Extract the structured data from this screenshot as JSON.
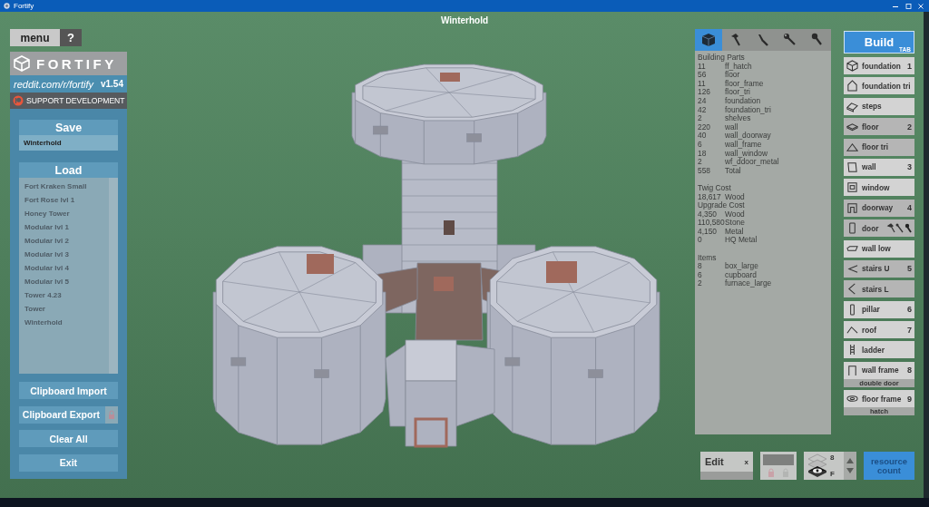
{
  "window": {
    "title": "Fortify"
  },
  "scene_title": "Winterhold",
  "menu": {
    "menu_button": "menu",
    "help_button": "?"
  },
  "brand": {
    "logo": "FORTIFY",
    "link": "reddit.com/r/fortify",
    "version": "v1.54",
    "support": "SUPPORT DEVELOPMENT"
  },
  "save": {
    "button": "Save",
    "value": "Winterhold"
  },
  "load": {
    "button": "Load",
    "items": [
      "Fort Kraken Small",
      "Fort Rose lvl 1",
      "Honey Tower",
      "Modular lvl 1",
      "Modular lvl 2",
      "Modular lvl 3",
      "Modular lvl 4",
      "Modular lvl 5",
      "Tower 4.23",
      "Tower",
      "Winterhold"
    ]
  },
  "actions": [
    {
      "label": "Clipboard Import",
      "locked": false
    },
    {
      "label": "Clipboard Export",
      "locked": true
    },
    {
      "label": "Clear All",
      "locked": false
    },
    {
      "label": "Exit",
      "locked": false
    }
  ],
  "stats": {
    "tabs": [
      {
        "selected": true
      },
      {
        "selected": false
      },
      {
        "selected": false
      },
      {
        "selected": false
      },
      {
        "selected": false
      }
    ],
    "groups": [
      {
        "sections": [
          {
            "title": "Building Parts",
            "rows": [
              {
                "count": "11",
                "name": "ff_hatch"
              },
              {
                "count": "56",
                "name": "floor"
              },
              {
                "count": "11",
                "name": "floor_frame"
              },
              {
                "count": "126",
                "name": "floor_tri"
              },
              {
                "count": "24",
                "name": "foundation"
              },
              {
                "count": "42",
                "name": "foundation_tri"
              },
              {
                "count": "2",
                "name": "shelves"
              },
              {
                "count": "220",
                "name": "wall"
              },
              {
                "count": "40",
                "name": "wall_doorway"
              },
              {
                "count": "6",
                "name": "wall_frame"
              },
              {
                "count": "18",
                "name": "wall_window"
              },
              {
                "count": "2",
                "name": "wf_ddoor_metal"
              },
              {
                "count": "558",
                "name": "Total"
              }
            ]
          }
        ]
      },
      {
        "sections": [
          {
            "title": "Twig Cost",
            "rows": [
              {
                "count": "18,617",
                "name": "Wood"
              }
            ]
          },
          {
            "title": "Upgrade Cost",
            "rows": [
              {
                "count": "4,350",
                "name": "Wood"
              },
              {
                "count": "110,580",
                "name": "Stone"
              },
              {
                "count": "4,150",
                "name": "Metal"
              },
              {
                "count": "0",
                "name": "HQ Metal"
              }
            ]
          }
        ]
      },
      {
        "sections": [
          {
            "title": "Items",
            "rows": [
              {
                "count": "8",
                "name": "box_large"
              },
              {
                "count": "6",
                "name": "cupboard"
              },
              {
                "count": "2",
                "name": "furnace_large"
              }
            ]
          }
        ]
      }
    ]
  },
  "build": {
    "button": "Build",
    "shortcut": "TAB",
    "items": [
      {
        "kind": "plain",
        "label": "foundation",
        "key": "1",
        "dimmed": false
      },
      {
        "kind": "plain",
        "label": "foundation tri",
        "dimmed": false
      },
      {
        "kind": "plain",
        "label": "steps",
        "dimmed": false
      },
      {
        "kind": "plain",
        "label": "floor",
        "key": "2",
        "dimmed": true
      },
      {
        "kind": "plain",
        "label": "floor tri",
        "dimmed": true
      },
      {
        "kind": "plain",
        "label": "wall",
        "key": "3",
        "dimmed": false
      },
      {
        "kind": "plain",
        "label": "window",
        "dimmed": false
      },
      {
        "kind": "plain",
        "label": "doorway",
        "key": "4",
        "dimmed": true
      },
      {
        "kind": "tools",
        "label": "door",
        "dimmed": true
      },
      {
        "kind": "plain",
        "label": "wall low",
        "dimmed": false
      },
      {
        "kind": "plain",
        "label": "stairs U",
        "key": "5",
        "dimmed": true
      },
      {
        "kind": "plain",
        "label": "stairs L",
        "dimmed": true
      },
      {
        "kind": "plain",
        "label": "pillar",
        "key": "6",
        "dimmed": false
      },
      {
        "kind": "plain",
        "label": "roof",
        "key": "7",
        "dimmed": false
      },
      {
        "kind": "plain",
        "label": "ladder",
        "dimmed": false
      },
      {
        "kind": "variant",
        "label": "wall frame",
        "key": "8",
        "sublabel": "double door",
        "dimmed": false
      },
      {
        "kind": "variant",
        "label": "floor frame",
        "key": "9",
        "sublabel": "hatch",
        "dimmed": false
      }
    ]
  },
  "toolbar": {
    "edit": {
      "label": "Edit",
      "close": "x"
    },
    "layer": {
      "count": "8",
      "floor": "F"
    },
    "resource_button": "resource count"
  }
}
